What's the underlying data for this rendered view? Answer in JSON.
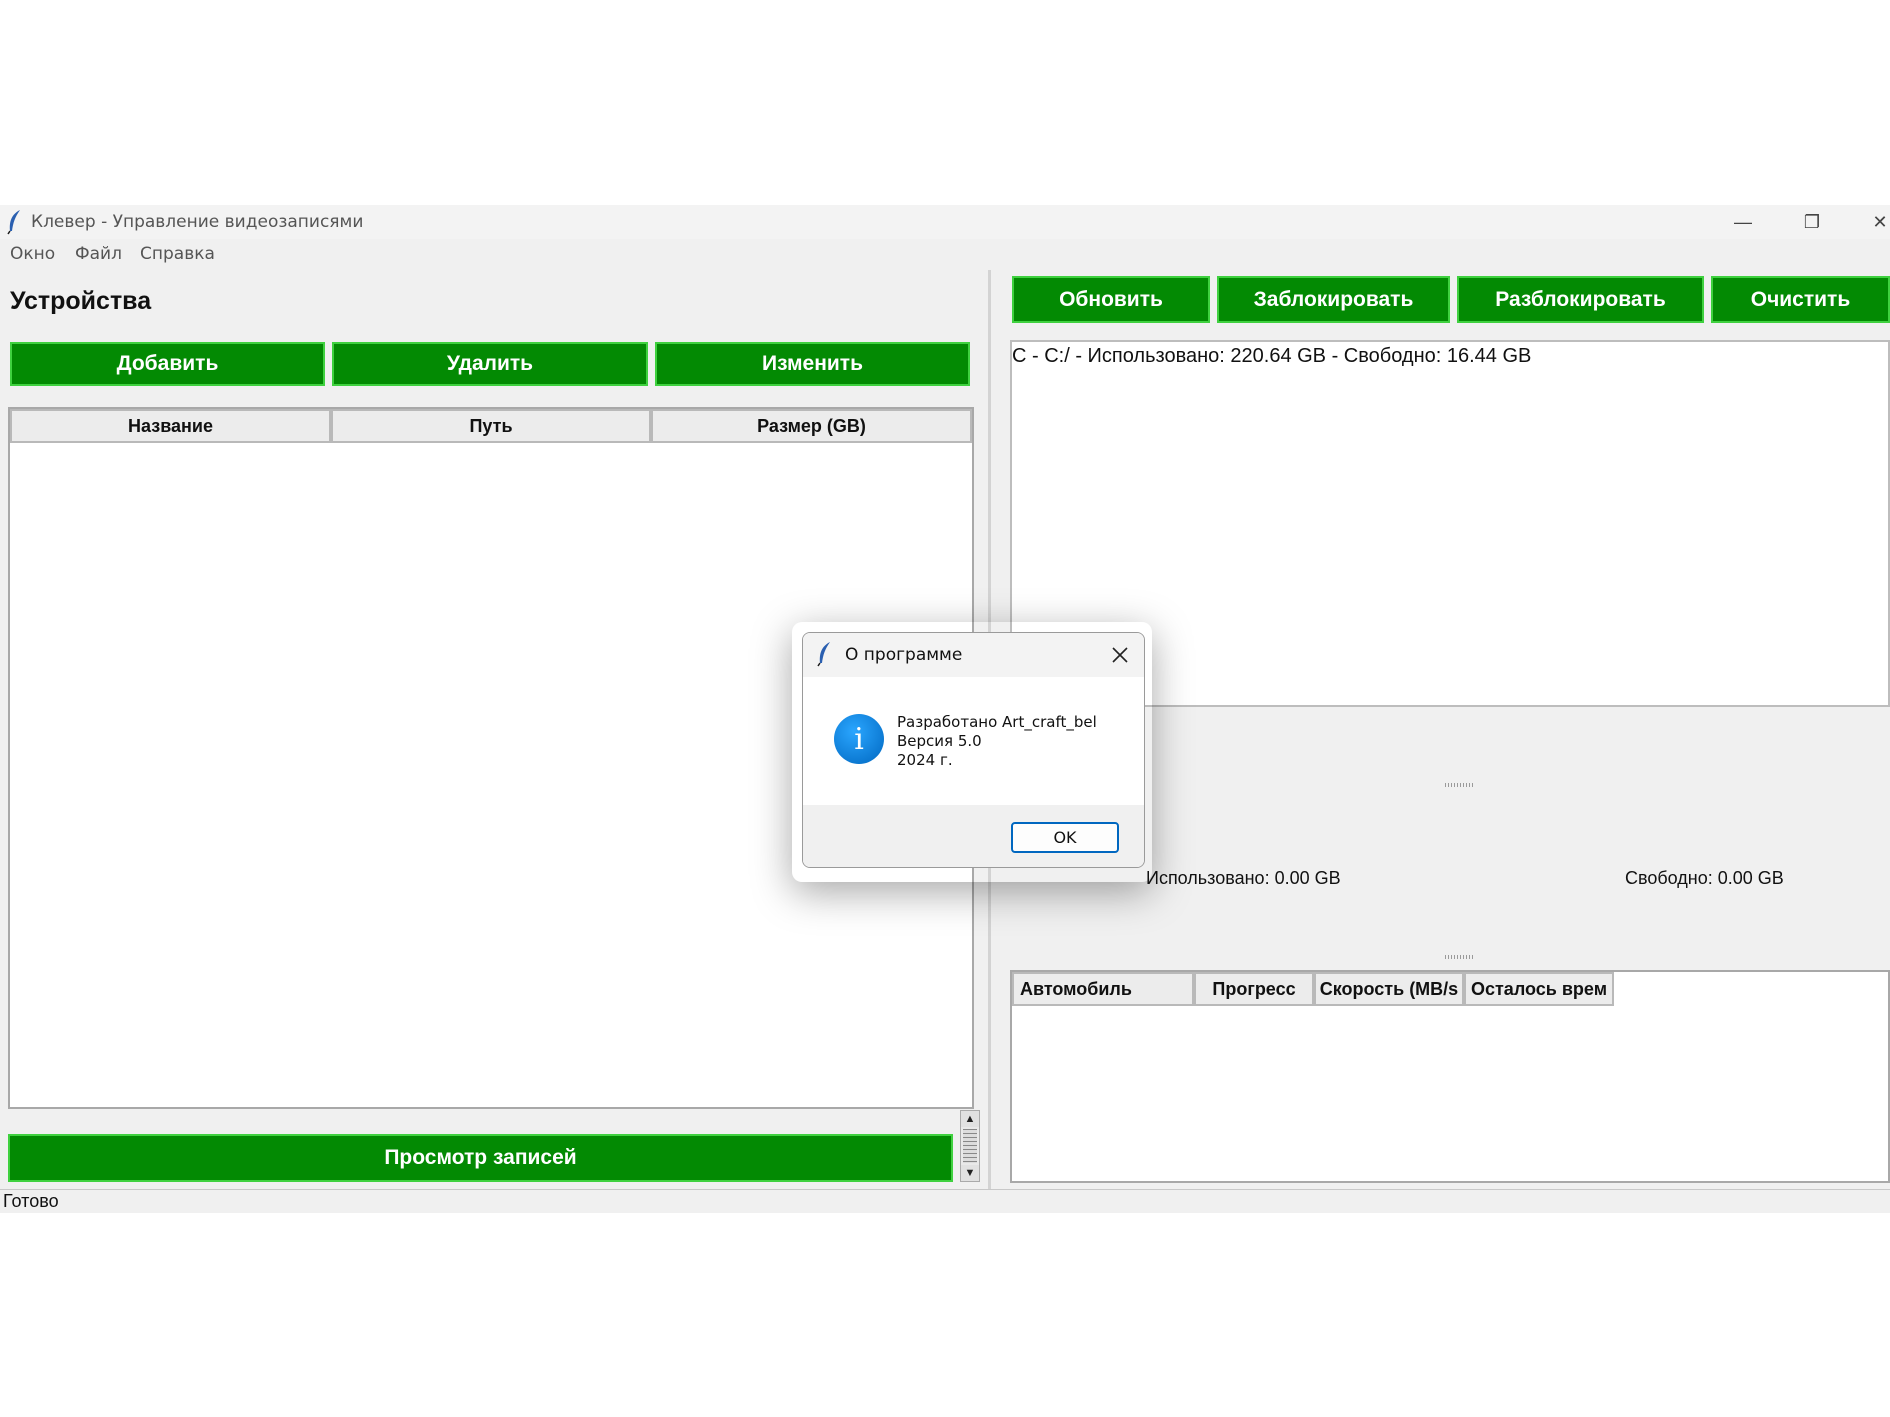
{
  "window": {
    "title": "Клевер - Управление видеозаписями",
    "controls": {
      "minimize": "—",
      "restore": "❐",
      "close": "✕"
    }
  },
  "menu": [
    "Окно",
    "Файл",
    "Справка"
  ],
  "devices": {
    "title": "Устройства",
    "buttons": {
      "add": "Добавить",
      "delete": "Удалить",
      "edit": "Изменить"
    },
    "columns": [
      "Название",
      "Путь",
      "Размер (GB)"
    ],
    "view_button": "Просмотр записей"
  },
  "toolbar": {
    "refresh": "Обновить",
    "block": "Заблокировать",
    "unblock": "Разблокировать",
    "clear": "Очистить"
  },
  "drives": {
    "line": "C - C:/ - Использовано: 220.64 GB - Свободно: 16.44 GB"
  },
  "usage": {
    "used": "Использовано: 0.00 GB",
    "free": "Свободно: 0.00 GB"
  },
  "transfers": {
    "columns": [
      "Автомобиль",
      "Прогресс",
      "Скорость (MB/s",
      "Осталось врем"
    ]
  },
  "status": "Готово",
  "dialog": {
    "title": "О программе",
    "message": "Разработано Art_craft_bel\nВерсия 5.0\n2024 г.",
    "icon": "info-icon",
    "ok": "OK"
  },
  "colors": {
    "button_green": "#038a03",
    "button_border": "#3fd13f",
    "accent_blue": "#0067c0"
  }
}
